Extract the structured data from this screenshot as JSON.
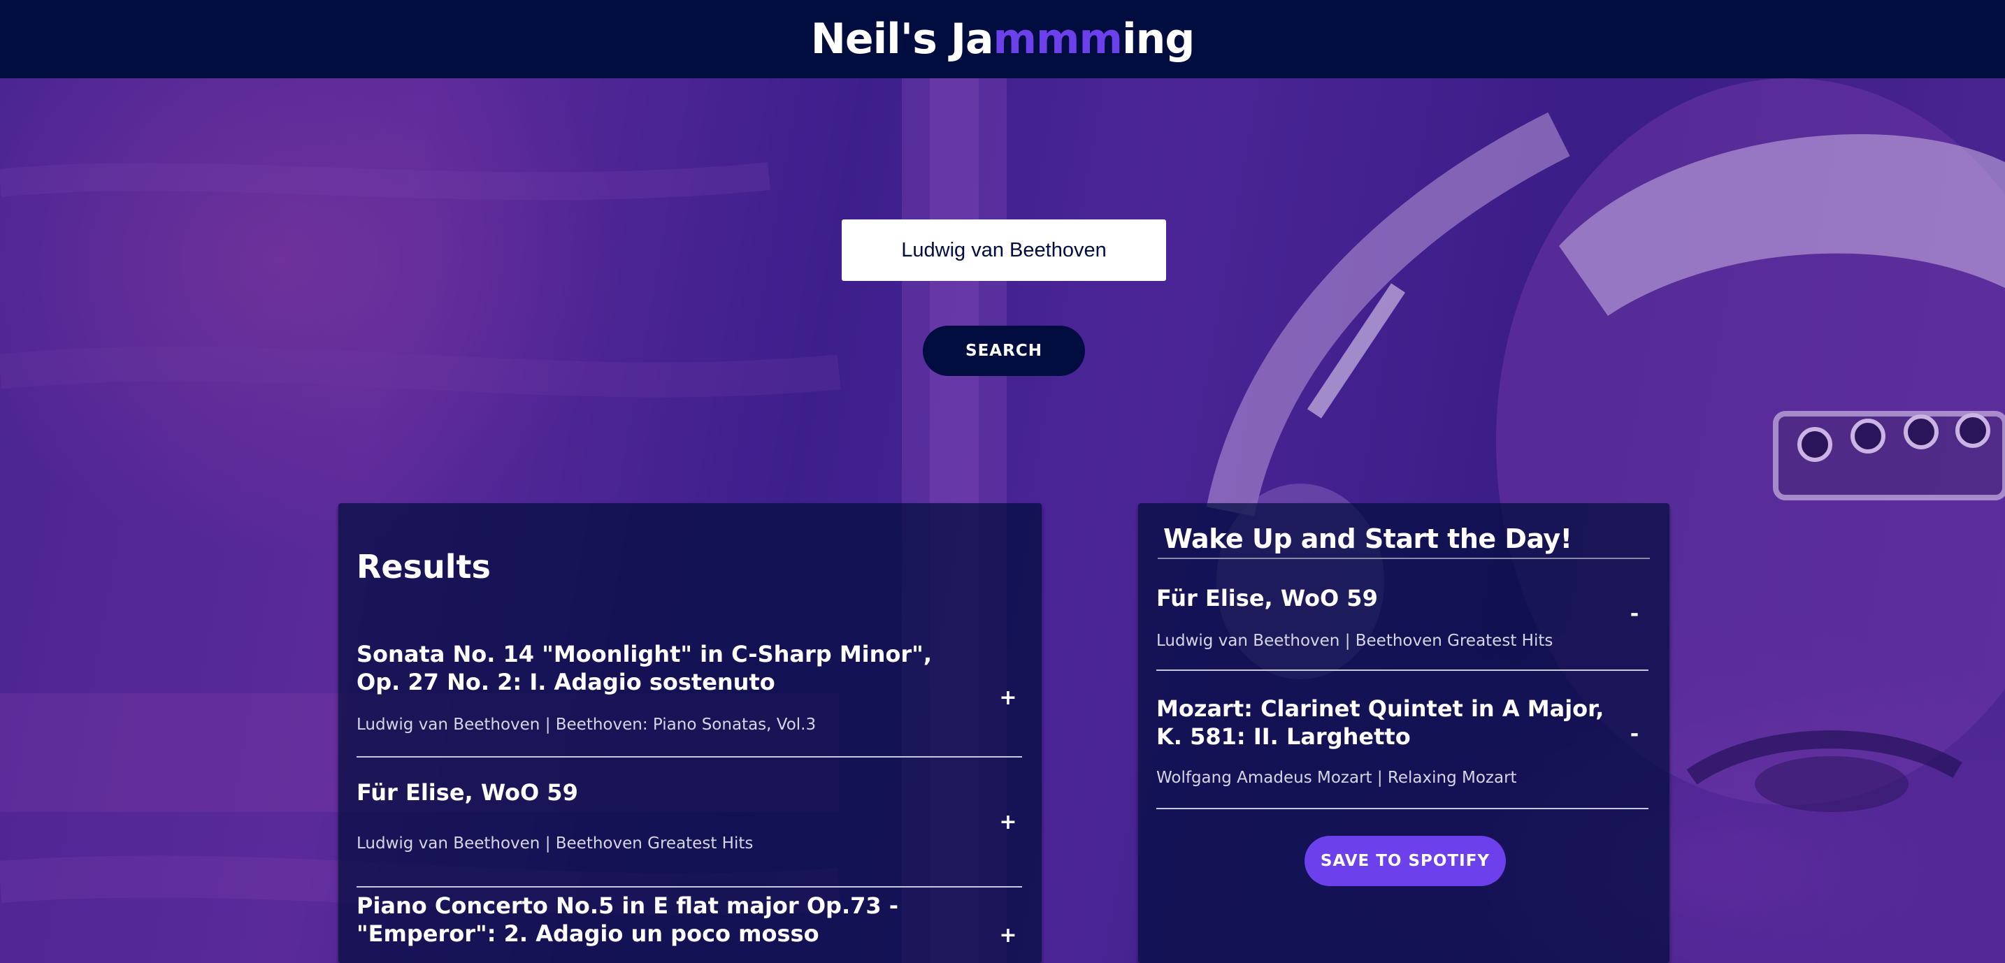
{
  "app": {
    "title_start": "Neil's Ja",
    "title_highlight": "mmm",
    "title_end": "ing"
  },
  "search": {
    "value": "Ludwig van Beethoven",
    "button_label": "SEARCH"
  },
  "results": {
    "heading": "Results",
    "tracks": [
      {
        "title": "Sonata No. 14 \"Moonlight\" in C-Sharp Minor\", Op. 27 No. 2: I. Adagio sostenuto",
        "meta": "Ludwig van Beethoven | Beethoven: Piano Sonatas, Vol.3",
        "action": "+"
      },
      {
        "title": "Für Elise, WoO 59",
        "meta": "Ludwig van Beethoven | Beethoven Greatest Hits",
        "action": "+"
      },
      {
        "title": "Piano Concerto No.5 in E flat major Op.73 -\"Emperor\": 2. Adagio un poco mosso",
        "meta": "",
        "action": "+"
      }
    ]
  },
  "playlist": {
    "name": "Wake Up and Start the Day!",
    "tracks": [
      {
        "title": "Für Elise, WoO 59",
        "meta": "Ludwig van Beethoven | Beethoven Greatest Hits",
        "action": "-"
      },
      {
        "title": "Mozart: Clarinet Quintet in A Major, K. 581: II. Larghetto",
        "meta": "Wolfgang Amadeus Mozart | Relaxing Mozart",
        "action": "-"
      }
    ],
    "save_label": "SAVE TO SPOTIFY"
  },
  "colors": {
    "navy": "#010c3f",
    "accent": "#6c41ec",
    "background_purple": "#4a2592"
  }
}
